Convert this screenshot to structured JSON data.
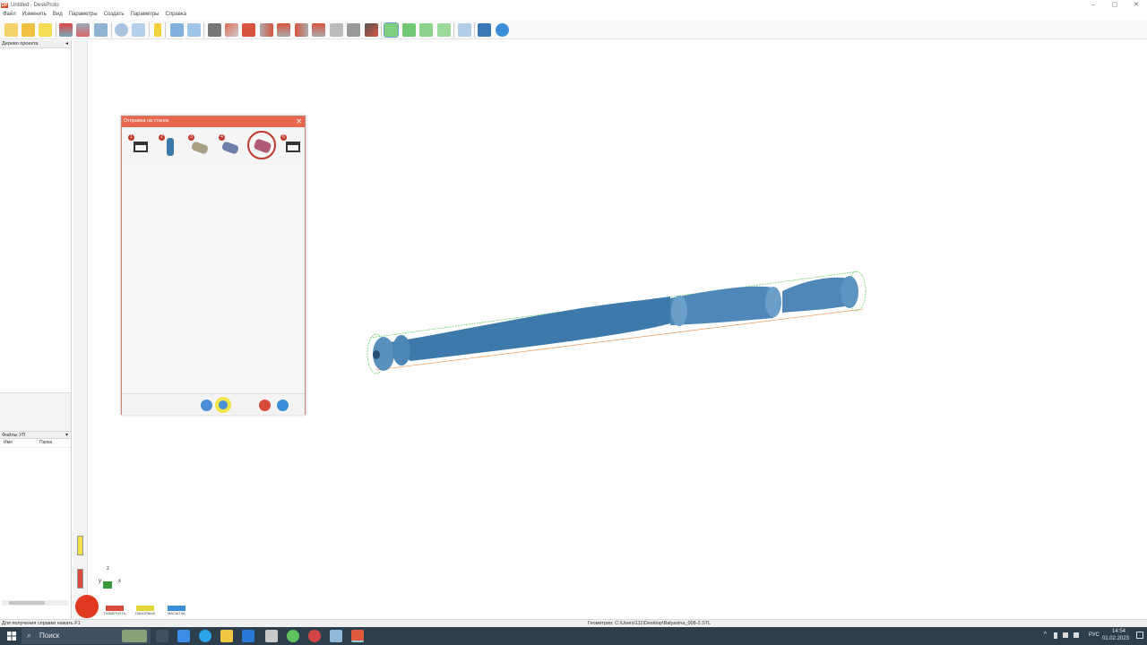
{
  "window": {
    "logo_text": "DP",
    "title": "Untitled - DeskProto",
    "controls": {
      "minimize": "–",
      "maximize": "▢",
      "close": "✕"
    }
  },
  "menu": [
    "Файл",
    "Изменить",
    "Вид",
    "Параметры",
    "Создать",
    "Параметры",
    "Справка"
  ],
  "toolbar": {
    "icons": [
      "new-file-icon",
      "open-file-icon",
      "save-file-icon",
      "sep",
      "import-icon",
      "tool-icon",
      "export-icon",
      "sep",
      "cloud-icon",
      "inspect-icon",
      "sep",
      "info-icon",
      "sep",
      "tile-icon",
      "window-icon",
      "sep",
      "camera-icon",
      "view-iso-icon",
      "view-front-icon",
      "view-back-icon",
      "view-left-icon",
      "view-right-icon",
      "view-top-icon",
      "view-bottom-icon",
      "view-box-icon",
      "print-icon",
      "sep",
      "rotate-icon",
      "pan-icon",
      "zoom-icon",
      "zoom-window-icon",
      "sep",
      "zoom-all-icon",
      "sep",
      "part-icon",
      "help-icon"
    ]
  },
  "left_panel": {
    "project_tree_label": "Дерево проекта",
    "files_label": "Файлы УП",
    "columns": [
      "Имя",
      "Папка"
    ],
    "pin_glyph": "◂",
    "dropdown_glyph": "▾"
  },
  "dialog": {
    "title": "Отправка на станок",
    "close_glyph": "✕",
    "steps": [
      {
        "num": "1",
        "name": "machine-step"
      },
      {
        "num": "2",
        "name": "part-step"
      },
      {
        "num": "3",
        "name": "stock-step"
      },
      {
        "num": "4",
        "name": "toolpath-step"
      },
      {
        "num": "5",
        "name": "simulate-step",
        "active": true
      },
      {
        "num": "6",
        "name": "send-step"
      }
    ]
  },
  "axis": {
    "z": "z",
    "y": "y",
    "x": "x"
  },
  "view_buttons": [
    "ПОВЕРНУТЬ",
    "ПАНОРАМА",
    "МАСШТАБ"
  ],
  "status": {
    "help": "Для получения справки нажать F1",
    "geometry": "Геометрия: C:\\Users\\111\\Desktop\\Balyasina_008-2.STL"
  },
  "taskbar": {
    "search_placeholder": "Поиск",
    "lang": "РУС",
    "time": "14:54",
    "date": "01.02.2023"
  },
  "colors": {
    "accent": "#e8684f",
    "model": "#4a7fa8",
    "bbox_green": "#6fd36f",
    "bbox_orange": "#f2a46a"
  }
}
